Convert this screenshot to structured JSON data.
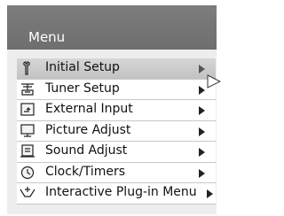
{
  "header": {
    "title": "Menu"
  },
  "menu": {
    "items": [
      {
        "label": "Initial Setup",
        "icon": "wrench-icon",
        "selected": true
      },
      {
        "label": "Tuner Setup",
        "icon": "antenna-icon",
        "selected": false
      },
      {
        "label": "External Input",
        "icon": "input-icon",
        "selected": false
      },
      {
        "label": "Picture Adjust",
        "icon": "monitor-icon",
        "selected": false
      },
      {
        "label": "Sound Adjust",
        "icon": "speaker-icon",
        "selected": false
      },
      {
        "label": "Clock/Timers",
        "icon": "clock-icon",
        "selected": false
      },
      {
        "label": "Interactive Plug-in Menu",
        "icon": "plugin-icon",
        "selected": false
      }
    ]
  },
  "colors": {
    "header_bg": "#757575",
    "menu_bg": "#ededed",
    "selected_bg": "#cccccc"
  }
}
